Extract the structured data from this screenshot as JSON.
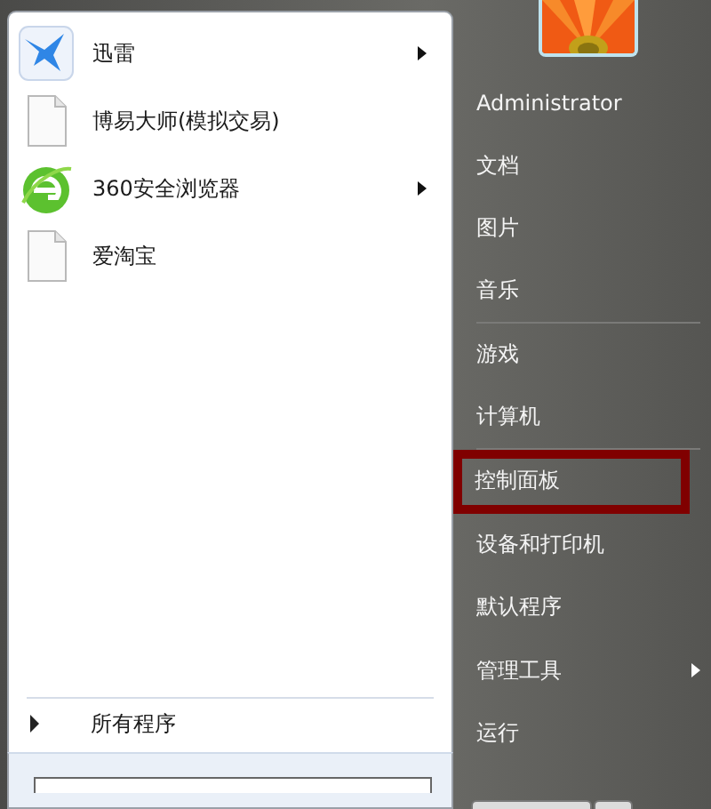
{
  "programs": [
    {
      "label": "迅雷",
      "kind": "app",
      "submenu": true
    },
    {
      "label": "博易大师(模拟交易)",
      "kind": "file",
      "submenu": false
    },
    {
      "label": "360安全浏览器",
      "kind": "browser",
      "submenu": true
    },
    {
      "label": "爱淘宝",
      "kind": "file",
      "submenu": false
    }
  ],
  "all_programs": {
    "label": "所有程序"
  },
  "user": {
    "name": "Administrator"
  },
  "places": [
    {
      "label": "文档",
      "submenu": false,
      "separator_after": false,
      "highlighted": false
    },
    {
      "label": "图片",
      "submenu": false,
      "separator_after": false,
      "highlighted": false
    },
    {
      "label": "音乐",
      "submenu": false,
      "separator_after": true,
      "highlighted": false
    },
    {
      "label": "游戏",
      "submenu": false,
      "separator_after": false,
      "highlighted": false
    },
    {
      "label": "计算机",
      "submenu": false,
      "separator_after": true,
      "highlighted": false
    },
    {
      "label": "控制面板",
      "submenu": false,
      "separator_after": false,
      "highlighted": true
    },
    {
      "label": "设备和打印机",
      "submenu": false,
      "separator_after": false,
      "highlighted": false
    },
    {
      "label": "默认程序",
      "submenu": false,
      "separator_after": false,
      "highlighted": false
    },
    {
      "label": "管理工具",
      "submenu": true,
      "separator_after": false,
      "highlighted": false
    },
    {
      "label": "运行",
      "submenu": false,
      "separator_after": false,
      "highlighted": false
    }
  ]
}
